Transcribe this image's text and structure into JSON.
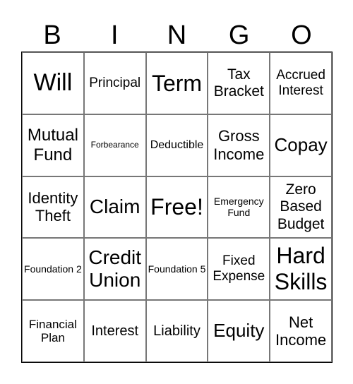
{
  "header": [
    "B",
    "I",
    "N",
    "G",
    "O"
  ],
  "cells": [
    [
      "Will",
      "Principal",
      "Term",
      "Tax Bracket",
      "Accrued Interest"
    ],
    [
      "Mutual Fund",
      "Forbearance",
      "Deductible",
      "Gross Income",
      "Copay"
    ],
    [
      "Identity Theft",
      "Claim",
      "Free!",
      "Emergency Fund",
      "Zero Based Budget"
    ],
    [
      "Foundation 2",
      "Credit Union",
      "Foundation 5",
      "Fixed Expense",
      "Hard Skills"
    ],
    [
      "Financial Plan",
      "Interest",
      "Liability",
      "Equity",
      "Net Income"
    ]
  ]
}
